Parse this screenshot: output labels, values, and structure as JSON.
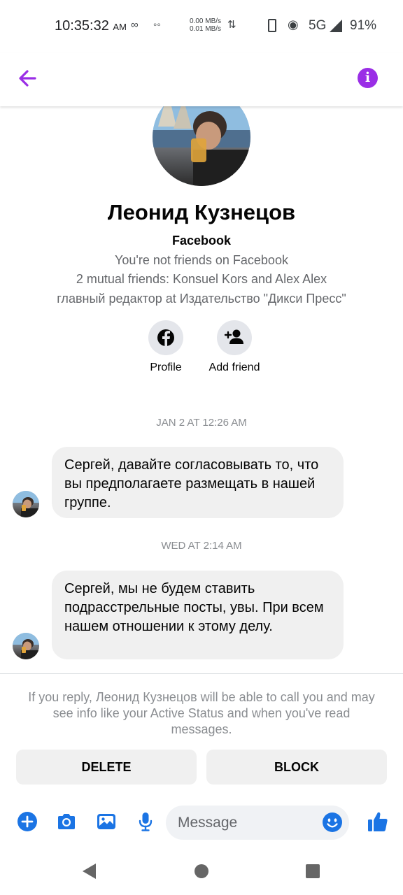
{
  "status_bar": {
    "time": "10:35:32",
    "ampm": "AM",
    "net_up": "0.00 MB/s",
    "net_down": "0.01 MB/s",
    "network": "5G",
    "battery": "91%"
  },
  "header": {
    "back_icon": "arrow-left-icon",
    "info_icon": "info-icon",
    "accent_color": "#9a2ee6"
  },
  "profile": {
    "name": "Леонид Кузнецов",
    "platform": "Facebook",
    "friend_status": "You're not friends on Facebook",
    "mutual": "2 mutual friends: Konsuel Kors and Alex Alex",
    "work": "главный редактор at Издательство \"Дикси Пресс\"",
    "actions": [
      {
        "label": "Profile",
        "icon": "facebook-icon"
      },
      {
        "label": "Add friend",
        "icon": "add-friend-icon"
      }
    ]
  },
  "messages": [
    {
      "timestamp": "JAN 2 AT 12:26 AM",
      "text": "Сергей, давайте согласовывать то, что вы предполагаете размещать в нашей группе."
    },
    {
      "timestamp": "WED AT 2:14 AM",
      "text": "Сергей, мы не будем ставить подрасстрельные посты, увы. При всем нашем отношении к этому делу."
    }
  ],
  "notice": "If you reply, Леонид Кузнецов will be able to call you and may see info like your Active Status and when you've read messages.",
  "buttons": {
    "delete": "DELETE",
    "block": "BLOCK"
  },
  "composer": {
    "placeholder": "Message",
    "icons": [
      "plus-icon",
      "camera-icon",
      "gallery-icon",
      "mic-icon",
      "emoji-icon",
      "like-icon"
    ],
    "icon_color": "#1b74e4"
  }
}
